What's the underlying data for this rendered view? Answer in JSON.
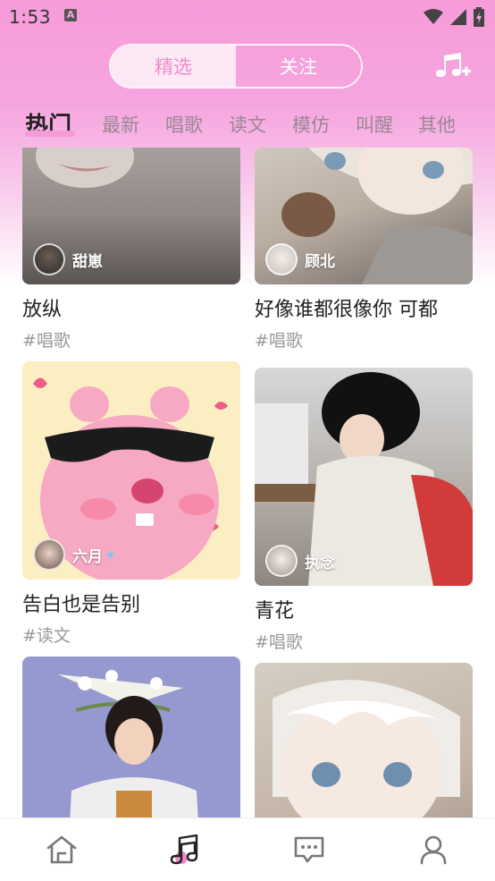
{
  "status": {
    "time": "1:53",
    "notification_letter": "A"
  },
  "header": {
    "segments": [
      {
        "label": "精选",
        "active": true
      },
      {
        "label": "关注",
        "active": false
      }
    ]
  },
  "tabs": [
    {
      "label": "热门",
      "active": true
    },
    {
      "label": "最新"
    },
    {
      "label": "唱歌"
    },
    {
      "label": "读文"
    },
    {
      "label": "模仿"
    },
    {
      "label": "叫醒"
    },
    {
      "label": "其他"
    }
  ],
  "feed": [
    {
      "author": "甜崽",
      "title": "放纵",
      "tag": "#唱歌"
    },
    {
      "author": "顾北",
      "title": "好像谁都很像你  可都",
      "tag": "#唱歌"
    },
    {
      "author": "六月",
      "title": "告白也是告别",
      "tag": "#读文"
    },
    {
      "author": "执念",
      "title": "青花",
      "tag": "#唱歌"
    },
    {
      "author": "",
      "title": "",
      "tag": ""
    },
    {
      "author": "",
      "title": "",
      "tag": ""
    }
  ],
  "bottom_nav": [
    {
      "icon": "home-icon",
      "active": false
    },
    {
      "icon": "music-note-icon",
      "active": true
    },
    {
      "icon": "message-icon",
      "active": false
    },
    {
      "icon": "profile-icon",
      "active": false
    }
  ],
  "colors": {
    "accent": "#f59bd6",
    "active_text": "#222222",
    "inactive_text": "#9b8796"
  }
}
